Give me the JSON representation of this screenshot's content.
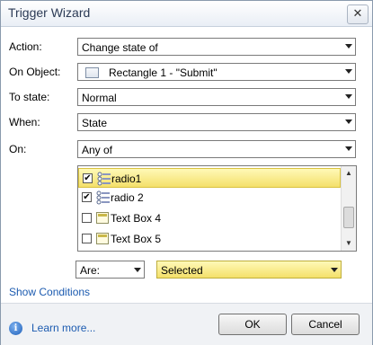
{
  "window": {
    "title": "Trigger Wizard",
    "close_label": "✕"
  },
  "form": {
    "action": {
      "label": "Action:",
      "value": "Change state of"
    },
    "on_object": {
      "label": "On Object:",
      "value": "Rectangle 1 - \"Submit\""
    },
    "to_state": {
      "label": "To state:",
      "value": "Normal"
    },
    "when": {
      "label": "When:",
      "value": "State"
    },
    "on": {
      "label": "On:",
      "value": "Any of"
    }
  },
  "object_list": {
    "items": [
      {
        "label": "radio1",
        "checked": true,
        "icon": "radio-group-icon",
        "selected": true
      },
      {
        "label": "radio 2",
        "checked": true,
        "icon": "radio-group-icon",
        "selected": false
      },
      {
        "label": "Text Box 4",
        "checked": false,
        "icon": "text-box-icon",
        "selected": false
      },
      {
        "label": "Text Box 5",
        "checked": false,
        "icon": "text-box-icon",
        "selected": false
      }
    ]
  },
  "condition": {
    "operator": "Are:",
    "state": "Selected"
  },
  "links": {
    "show_conditions": "Show Conditions",
    "learn_more": "Learn more..."
  },
  "buttons": {
    "ok": "OK",
    "cancel": "Cancel"
  },
  "colors": {
    "highlight": "#f7e57a",
    "link": "#1c5bb0",
    "title_text": "#2b3a55"
  }
}
